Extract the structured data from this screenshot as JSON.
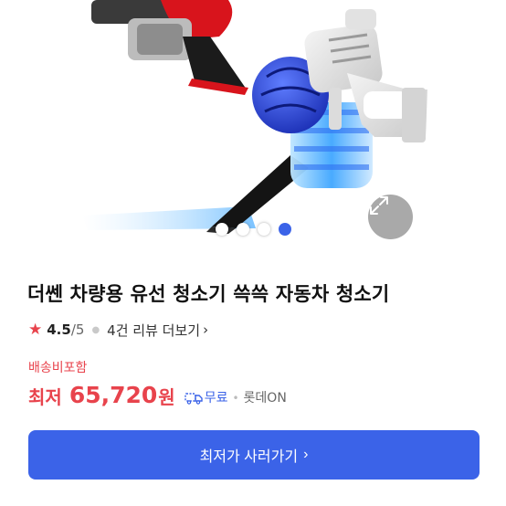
{
  "product": {
    "image_alt": "handheld vacuum cleaner product photo",
    "title": "더쎈 차량용 유선 청소기 쓱쓱 자동차 청소기",
    "rating": "4.5",
    "rating_max": "/5",
    "reviews_label": "4건 리뷰 더보기",
    "reviews_chevron": "›"
  },
  "carousel": {
    "slide_count": 4,
    "active_index": 3
  },
  "price": {
    "shipping_note": "배송비포함",
    "prefix": "최저",
    "value": "65,720",
    "unit": "원",
    "shipping_free": "무료",
    "mall": "롯데ON"
  },
  "cta": {
    "label": "최저가 사러가기",
    "chevron": "›"
  },
  "colors": {
    "accent_blue": "#3b63e8",
    "price_red": "#e8434c"
  },
  "icons": {
    "rating": "star-icon",
    "expand": "expand-arrows-icon",
    "shipping": "truck-icon"
  }
}
